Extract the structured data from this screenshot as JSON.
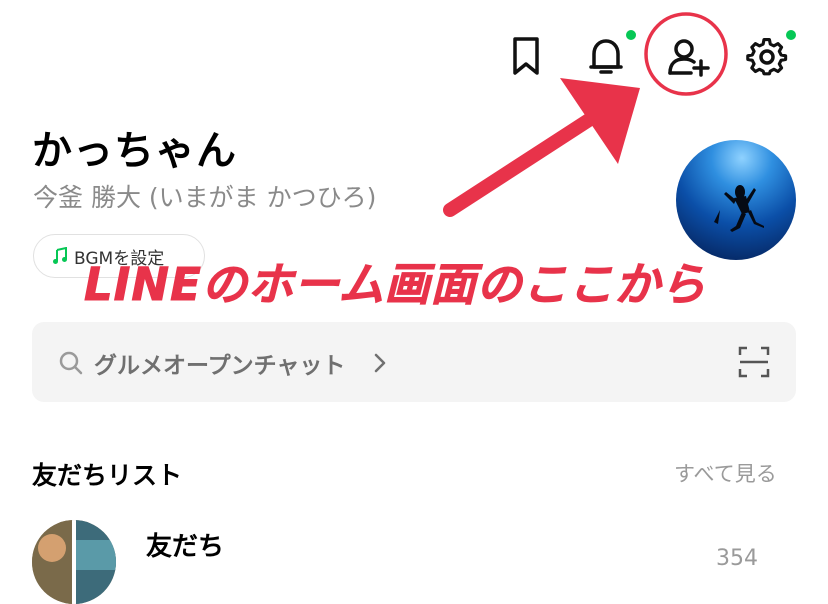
{
  "header": {
    "icons": [
      "bookmark-icon",
      "bell-icon",
      "add-friend-icon",
      "gear-icon"
    ],
    "notification_color": "#06c755"
  },
  "profile": {
    "name": "かっちゃん",
    "subtitle": "今釜 勝大 (いまがま かつひろ)",
    "bgm_label": "BGMを設定",
    "bgm_color": "#06c755"
  },
  "search": {
    "text": "グルメオープンチャット"
  },
  "friends_section": {
    "title": "友だちリスト",
    "see_all": "すべて見る",
    "item_label": "友だち",
    "item_count": "354"
  },
  "annotation": {
    "text": "LINEのホーム画面のここから",
    "color": "#e8334a"
  }
}
